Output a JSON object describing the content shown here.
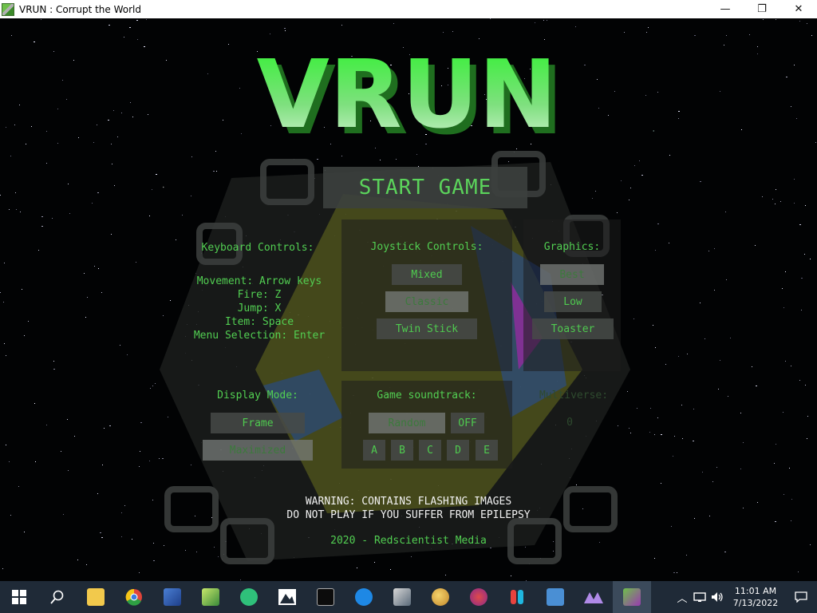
{
  "window": {
    "title": "VRUN : Corrupt the World",
    "controls": {
      "minimize": "—",
      "maximize": "❐",
      "close": "✕"
    }
  },
  "game": {
    "logo_text": "VRUN",
    "start_label": "START GAME",
    "keyboard": {
      "title": "Keyboard Controls:",
      "lines": [
        "Movement: Arrow keys",
        "Fire: Z",
        "Jump: X",
        "Item: Space",
        "Menu Selection: Enter"
      ]
    },
    "joystick": {
      "title": "Joystick Controls:",
      "options": [
        "Mixed",
        "Classic",
        "Twin Stick"
      ],
      "selected": "Classic"
    },
    "graphics": {
      "title": "Graphics:",
      "options": [
        "Best",
        "Low",
        "Toaster"
      ],
      "selected": "Best"
    },
    "display": {
      "title": "Display Mode:",
      "options": [
        "Frame",
        "Maximized"
      ],
      "selected": "Maximized"
    },
    "soundtrack": {
      "title": "Game soundtrack:",
      "random": "Random",
      "off": "OFF",
      "tracks": [
        "A",
        "B",
        "C",
        "D",
        "E"
      ]
    },
    "multiverse": {
      "title": "Multiverse:",
      "value": "0"
    },
    "warning": [
      "WARNING: CONTAINS FLASHING IMAGES",
      "DO NOT PLAY IF YOU SUFFER FROM EPILEPSY"
    ],
    "credit": "2020 - Redscientist Media"
  },
  "taskbar": {
    "items": [
      "start-icon",
      "search-icon",
      "file-explorer-icon",
      "chrome-icon",
      "remote-desktop-icon",
      "notepad-icon",
      "sync-icon",
      "photos-icon",
      "terminal-icon",
      "app-m-icon",
      "image-viewer-icon",
      "paint-icon",
      "palette-icon",
      "switch-icon",
      "system-info-icon",
      "affinity-icon",
      "vrun-icon"
    ],
    "time": "11:01 AM",
    "date": "7/13/2022"
  },
  "colors": {
    "accent_green": "#52cf52",
    "taskbar": "#1f2a37",
    "background": "#020304"
  }
}
